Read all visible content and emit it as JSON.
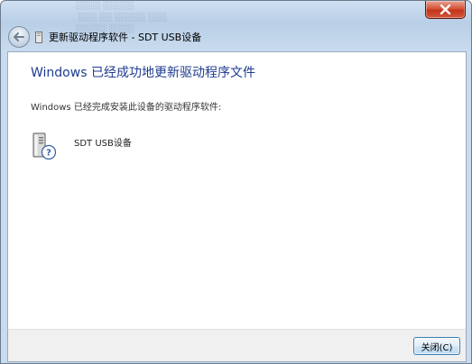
{
  "window": {
    "title": "更新驱动程序软件 - SDT USB设备",
    "close_icon": "close-icon",
    "back_icon": "back-arrow-icon"
  },
  "content": {
    "heading": "Windows 已经成功地更新驱动程序文件",
    "message": "Windows 已经完成安装此设备的驱动程序软件:",
    "device": {
      "name": "SDT USB设备",
      "icon": "unknown-device-computer-icon"
    }
  },
  "footer": {
    "close_label": "关闭(C)"
  },
  "colors": {
    "heading": "#1e3b8f",
    "frame": "#c9dbee",
    "close_red": "#c33219",
    "button_border": "#3c7fb1"
  }
}
